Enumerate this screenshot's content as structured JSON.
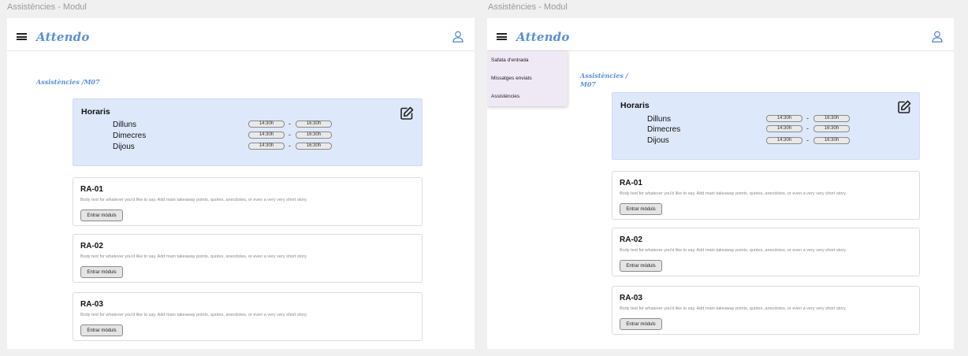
{
  "frames": [
    {
      "label": "Assistències - Modul",
      "header": {
        "logo": "Attendo"
      },
      "breadcrumb": "Assistències /M07",
      "horaris": {
        "title": "Horaris",
        "schedule": [
          {
            "day": "Dilluns",
            "start": "14:30h",
            "end": "16:30h"
          },
          {
            "day": "Dimecres",
            "start": "14:30h",
            "end": "16:30h"
          },
          {
            "day": "Dijous",
            "start": "14:30h",
            "end": "16:30h"
          }
        ],
        "separator": "-"
      },
      "cards": [
        {
          "title": "RA-01",
          "body": "Body text for whatever you'd like to say. Add main takeaway points, quotes, anecdotes, or even a very very short story.",
          "button": "Entrar móduls"
        },
        {
          "title": "RA-02",
          "body": "Body text for whatever you'd like to say. Add main takeaway points, quotes, anecdotes, or even a very very short story.",
          "button": "Entrar móduls"
        },
        {
          "title": "RA-03",
          "body": "Body text for whatever you'd like to say. Add main takeaway points, quotes, anecdotes, or even a very very short story.",
          "button": "Entrar móduls"
        }
      ]
    },
    {
      "label": "Assistències - Modul",
      "header": {
        "logo": "Attendo"
      },
      "menu": {
        "items": [
          "Safata d'entrada",
          "Missatges enviats",
          "Assistències"
        ]
      },
      "breadcrumb_line1": "Assistències /",
      "breadcrumb_line2": "M07",
      "horaris": {
        "title": "Horaris",
        "schedule": [
          {
            "day": "Dilluns",
            "start": "14:30h",
            "end": "16:30h"
          },
          {
            "day": "Dimecres",
            "start": "14:30h",
            "end": "16:30h"
          },
          {
            "day": "Dijous",
            "start": "14:30h",
            "end": "16:30h"
          }
        ],
        "separator": "-"
      },
      "cards": [
        {
          "title": "RA-01",
          "body": "Body text for whatever you'd like to say. Add main takeaway points, quotes, anecdotes, or even a very very short story.",
          "button": "Entrar móduls"
        },
        {
          "title": "RA-02",
          "body": "Body text for whatever you'd like to say. Add main takeaway points, quotes, anecdotes, or even a very very short story.",
          "button": "Entrar móduls"
        },
        {
          "title": "RA-03",
          "body": "Body text for whatever you'd like to say. Add main takeaway points, quotes, anecdotes, or even a very very short story.",
          "button": "Entrar móduls"
        }
      ]
    }
  ],
  "colors": {
    "accent": "#5a8fd8",
    "horaris_bg": "#dde8fb",
    "menu_bg": "#efe9f6",
    "page_bg": "#f0f0f0"
  },
  "icons": [
    "hamburger-menu-icon",
    "user-icon",
    "edit-icon"
  ]
}
